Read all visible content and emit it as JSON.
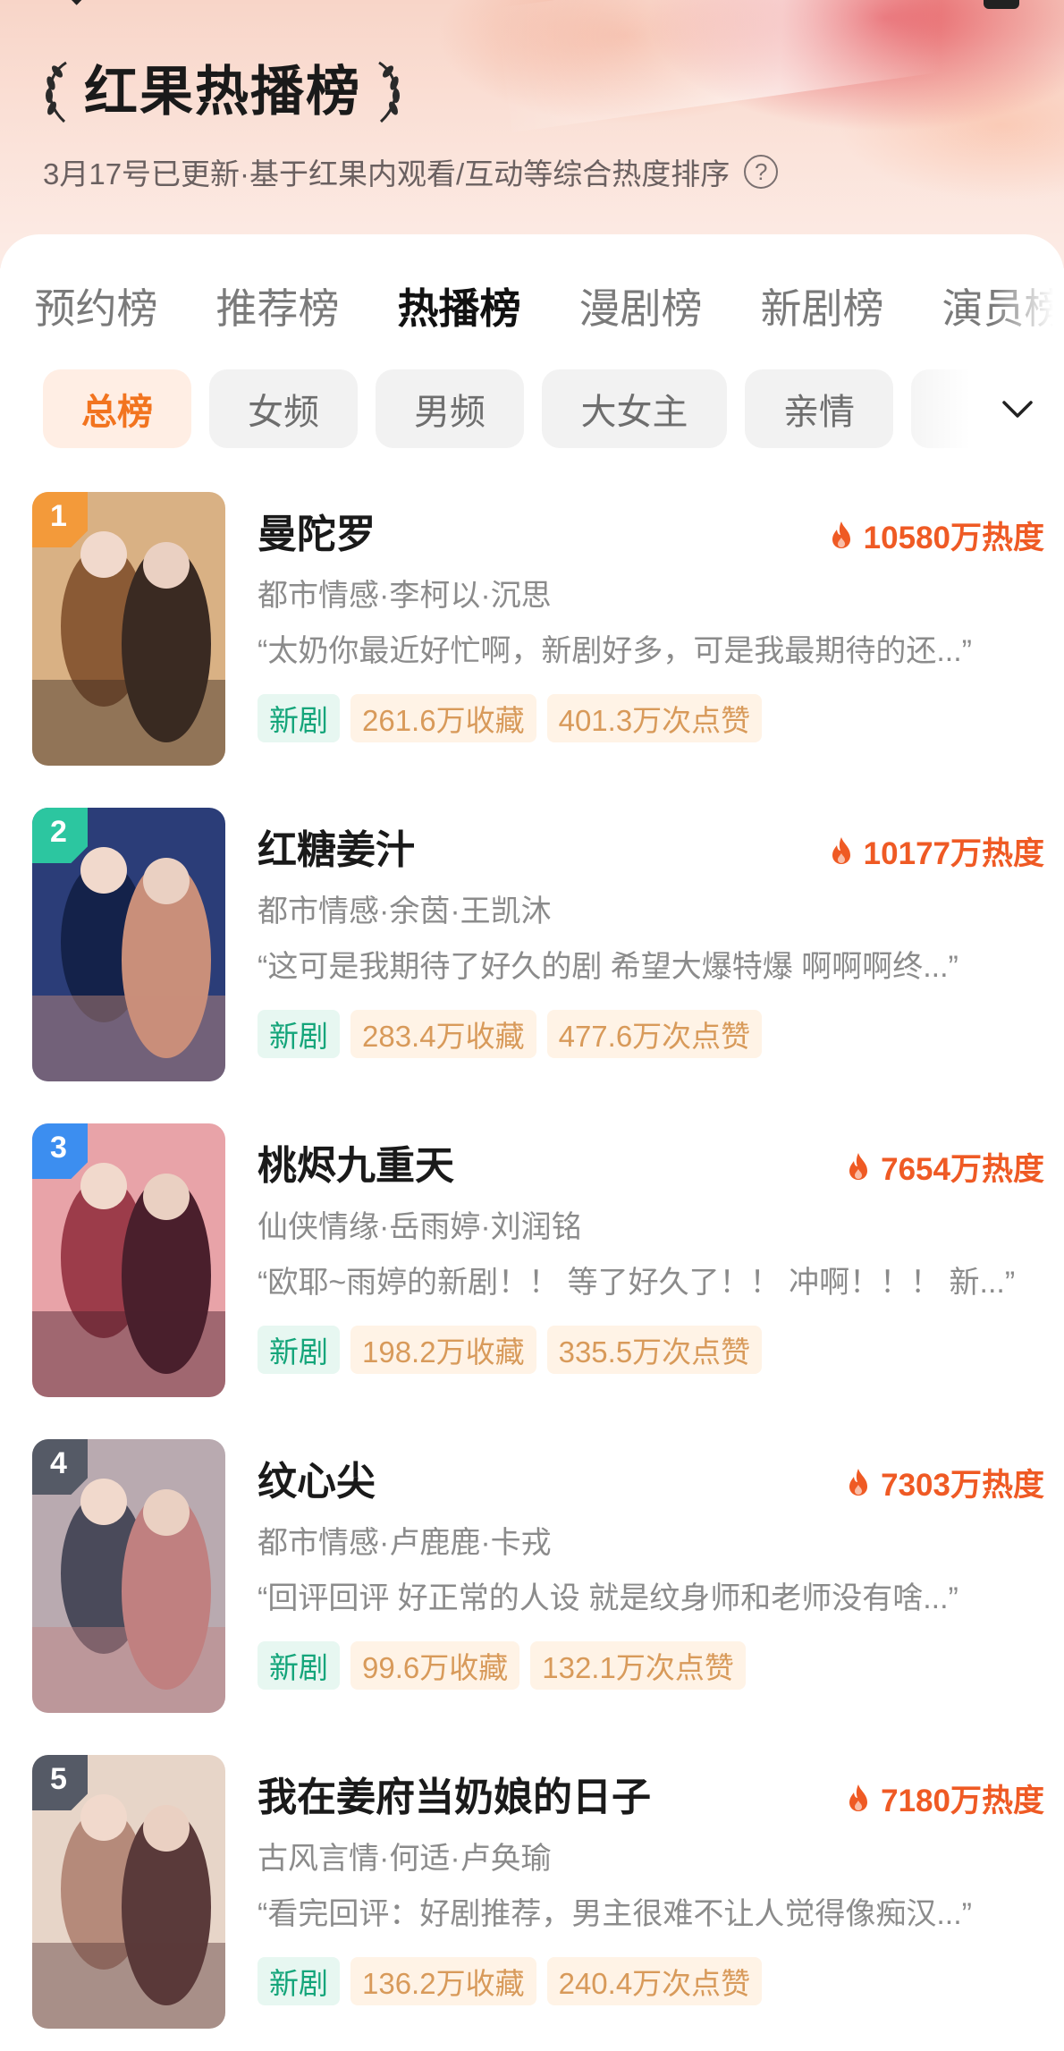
{
  "header": {
    "title": "红果热播榜",
    "subtitle": "3月17号已更新·基于红果内观看/互动等综合热度排序",
    "help_icon": "?"
  },
  "tabs": [
    {
      "label": "预约榜",
      "active": false
    },
    {
      "label": "推荐榜",
      "active": false
    },
    {
      "label": "热播榜",
      "active": true
    },
    {
      "label": "漫剧榜",
      "active": false
    },
    {
      "label": "新剧榜",
      "active": false
    },
    {
      "label": "演员榜",
      "active": false
    }
  ],
  "filters": [
    {
      "label": "总榜",
      "active": true
    },
    {
      "label": "女频",
      "active": false
    },
    {
      "label": "男频",
      "active": false
    },
    {
      "label": "大女主",
      "active": false
    },
    {
      "label": "亲情",
      "active": false
    },
    {
      "label": "",
      "active": false
    }
  ],
  "colors": {
    "accent": "#f2741f",
    "heat": "#ef5a24",
    "new_tag_bg": "#e7f7f1",
    "new_tag_text": "#14a57a",
    "stat_tag_bg": "#fff3e6",
    "stat_tag_text": "#d89a5a"
  },
  "items": [
    {
      "rank": "1",
      "rank_color": "#f39a3a",
      "title": "曼陀罗",
      "heat": "10580万热度",
      "meta": "都市情感·李柯以·沉思",
      "quote": "“太奶你最近好忙啊，新剧好多，可是我最期待的还...”",
      "tags": [
        "新剧",
        "261.6万收藏",
        "401.3万次点赞"
      ],
      "poster_colors": [
        "#d9b184",
        "#8a5a35",
        "#3a2a22"
      ]
    },
    {
      "rank": "2",
      "rank_color": "#2cc6a0",
      "title": "红糖姜汁",
      "heat": "10177万热度",
      "meta": "都市情感·余茵·王凯沐",
      "quote": "“这可是我期待了好久的剧 希望大爆特爆 啊啊啊终...”",
      "tags": [
        "新剧",
        "283.4万收藏",
        "477.6万次点赞"
      ],
      "poster_colors": [
        "#2b3d78",
        "#14224a",
        "#c98f7a"
      ]
    },
    {
      "rank": "3",
      "rank_color": "#3c8ef0",
      "title": "桃烬九重天",
      "heat": "7654万热度",
      "meta": "仙侠情缘·岳雨婷·刘润铭",
      "quote": "“欧耶~雨婷的新剧！！ 等了好久了！！ 冲啊！！！ 新...”",
      "tags": [
        "新剧",
        "198.2万收藏",
        "335.5万次点赞"
      ],
      "poster_colors": [
        "#e8a3a8",
        "#9c3c4a",
        "#4a1f2c"
      ]
    },
    {
      "rank": "4",
      "rank_color": "#555a66",
      "title": "纹心尖",
      "heat": "7303万热度",
      "meta": "都市情感·卢鹿鹿·卡戎",
      "quote": "“回评回评 好正常的人设 就是纹身师和老师没有啥...”",
      "tags": [
        "新剧",
        "99.6万收藏",
        "132.1万次点赞"
      ],
      "poster_colors": [
        "#b9aab0",
        "#4a4a5a",
        "#c08080"
      ]
    },
    {
      "rank": "5",
      "rank_color": "#555a66",
      "title": "我在姜府当奶娘的日子",
      "heat": "7180万热度",
      "meta": "古风言情·何适·卢奂瑜",
      "quote": "“看完回评：好剧推荐，男主很难不让人觉得像痴汉...”",
      "tags": [
        "新剧",
        "136.2万收藏",
        "240.4万次点赞"
      ],
      "poster_colors": [
        "#e7d5c8",
        "#b58a7a",
        "#5a3a3a"
      ]
    }
  ]
}
